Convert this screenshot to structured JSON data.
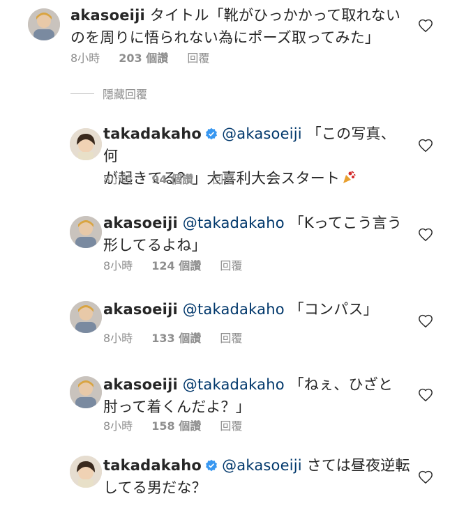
{
  "comments": [
    {
      "username": "akasoeiji",
      "mention": "",
      "text_line1": "タイトル「靴がひっかかって取れない",
      "text_line2": "のを周りに悟られない為にポーズ取ってみた」",
      "time": "8小時",
      "likes": "203 個讚",
      "reply": "回覆"
    },
    {
      "username": "takadakaho",
      "mention": "@akasoeiji",
      "text_line1": "「この写真、何",
      "text_line2": "が起きてる？」大喜利大会スタート",
      "time": "8小時",
      "likes": "94 個讚",
      "reply": "回覆"
    },
    {
      "username": "akasoeiji",
      "mention": "@takadakaho",
      "text_line1": "「Kってこう言う",
      "text_line2": "形してるよね」",
      "time": "8小時",
      "likes": "124 個讚",
      "reply": "回覆"
    },
    {
      "username": "akasoeiji",
      "mention": "@takadakaho",
      "text_line1": "「コンパス」",
      "text_line2": "",
      "time": "8小時",
      "likes": "133 個讚",
      "reply": "回覆"
    },
    {
      "username": "akasoeiji",
      "mention": "@takadakaho",
      "text_line1": "「ねぇ、ひざと",
      "text_line2": "肘って着くんだよ？」",
      "time": "8小時",
      "likes": "158 個讚",
      "reply": "回覆"
    },
    {
      "username": "takadakaho",
      "mention": "@akasoeiji",
      "text_line1": "さては昼夜逆転",
      "text_line2": "してる男だな？",
      "time": "",
      "likes": "",
      "reply": ""
    }
  ],
  "hidden_replies": "隱藏回覆",
  "icons": {
    "like": "heart-icon",
    "verified": "verified-badge-icon",
    "emoji": "party-emoji-icon"
  },
  "colors": {
    "mention": "#00376b",
    "meta": "#8e8e8e",
    "verified": "#3897f0"
  }
}
